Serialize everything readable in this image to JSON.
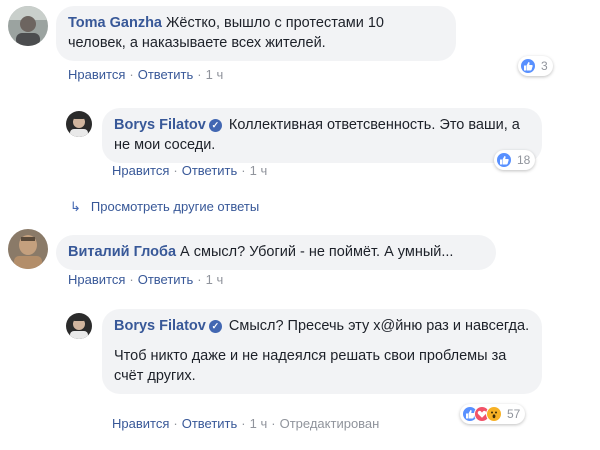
{
  "comments": [
    {
      "author": "Toma Ganzha",
      "text": "Жёстко, вышло с протестами 10 человек, а наказываете всех жителей.",
      "like": "Нравится",
      "reply": "Ответить",
      "time": "1 ч",
      "reactions": "3",
      "reaction_types": [
        "like"
      ]
    },
    {
      "author": "Borys Filatov",
      "verified": true,
      "text": "Коллективная ответсвенность. Это ваши, а не мои соседи.",
      "like": "Нравится",
      "reply": "Ответить",
      "time": "1 ч",
      "reactions": "18",
      "reaction_types": [
        "like"
      ]
    },
    {
      "author": "Виталий Глоба",
      "text": "А смысл? Убогий - не поймёт. А умный...",
      "like": "Нравится",
      "reply": "Ответить",
      "time": "1 ч"
    },
    {
      "author": "Borys Filatov",
      "verified": true,
      "text_p1": "Смысл? Пресечь эту х@йню раз и навсегда.",
      "text_p2": "Чтоб никто даже и не надеялся решать свои проблемы за счёт других.",
      "like": "Нравится",
      "reply": "Ответить",
      "time": "1 ч",
      "edited": "Отредактирован",
      "reactions": "57",
      "reaction_types": [
        "like",
        "love",
        "wow"
      ]
    }
  ],
  "view_more_replies": "Просмотреть другие ответы",
  "colors": {
    "link": "#385898",
    "bubble": "#f2f3f5",
    "meta": "#90949c",
    "like_blue": "#5890ff"
  },
  "icons": [
    "verified-badge-icon",
    "thumbs-up-icon",
    "heart-icon",
    "wow-face-icon",
    "reply-arrow-icon"
  ]
}
